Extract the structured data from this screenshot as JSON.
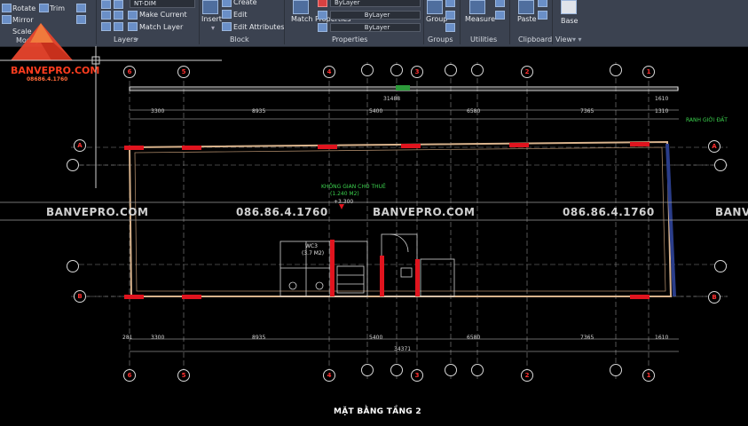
{
  "ribbon": {
    "modify": {
      "rotate": "Rotate",
      "trim": "Trim",
      "mirror": "Mirror",
      "scale": "Scale",
      "panel": "Modify"
    },
    "layers": {
      "layer_value": "NT-DIM",
      "make_current": "Make Current",
      "match_layer": "Match Layer",
      "panel": "Layers"
    },
    "block": {
      "insert": "Insert",
      "create": "Create",
      "edit": "Edit",
      "edit_attributes": "Edit Attributes",
      "panel": "Block"
    },
    "properties": {
      "match_properties": "Match Properties",
      "color": "ByLayer",
      "linetype": "ByLayer",
      "lineweight": "ByLayer",
      "panel": "Properties"
    },
    "groups": {
      "group": "Group",
      "panel": "Groups"
    },
    "utilities": {
      "measure": "Measure",
      "panel": "Utilities"
    },
    "clipboard": {
      "paste": "Paste",
      "panel": "Clipboard"
    },
    "view": {
      "base": "Base",
      "panel": "View"
    }
  },
  "logo": {
    "name": "BANVEPRO.COM",
    "phone": "08686.4.1760"
  },
  "watermark": {
    "site": "BANVEPRO.COM",
    "phone": "086.86.4.1760",
    "site_partial": "BANVE"
  },
  "drawing": {
    "title": "MẶT BẰNG TẦNG 2",
    "grid_top": [
      "6",
      "5",
      "4",
      "3",
      "2",
      "1"
    ],
    "grid_bottom": [
      "6",
      "5",
      "4",
      "3",
      "2",
      "1"
    ],
    "grid_side": [
      "A",
      "B"
    ],
    "dims_top": [
      "3300",
      "8935",
      "5400",
      "6580",
      "7365",
      "1310"
    ],
    "dim_top_total": "31488",
    "dim_top_right": "1610",
    "dims_bottom": [
      "281",
      "3300",
      "8935",
      "5400",
      "6580",
      "7365",
      "1610"
    ],
    "dim_bottom_total": "34371",
    "boundary_label": "RANH GIỚI ĐẤT",
    "space_label": "KHÔNG GIAN CHO THUÊ",
    "space_area": "(1.240 M2)",
    "level": "+3.300",
    "wc_label": "WC3",
    "wc_area": "(3.7 M2)"
  }
}
